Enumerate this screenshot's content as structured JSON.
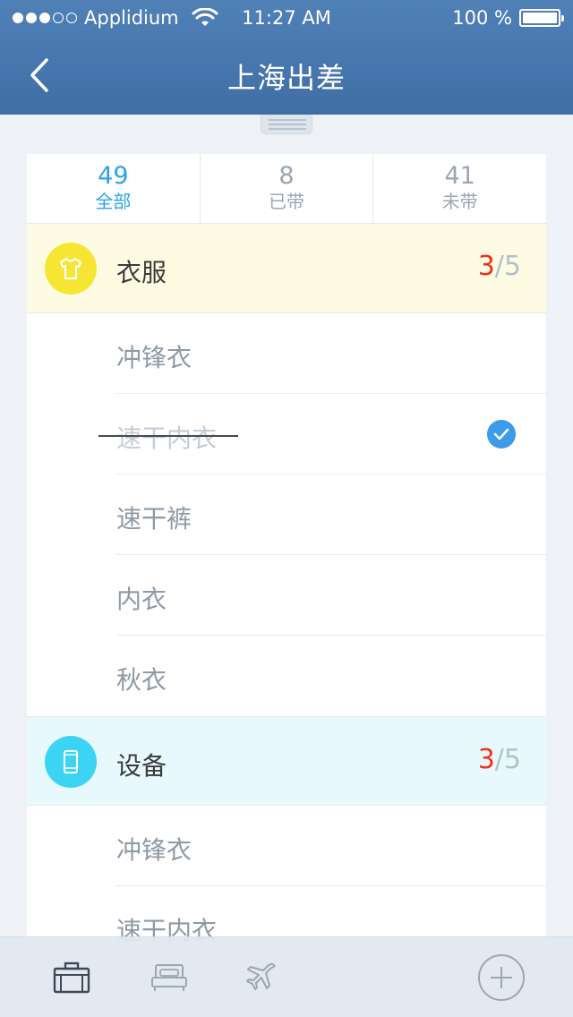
{
  "status": {
    "carrier": "Applidium",
    "time": "11:27 AM",
    "battery": "100 %"
  },
  "header": {
    "title": "上海出差"
  },
  "tabs": [
    {
      "count": "49",
      "label": "全部"
    },
    {
      "count": "8",
      "label": "已带"
    },
    {
      "count": "41",
      "label": "未带"
    }
  ],
  "categories": [
    {
      "name": "衣服",
      "done": "3",
      "total": "/5",
      "color": "#f7e534",
      "items": [
        {
          "label": "冲锋衣",
          "checked": false
        },
        {
          "label": "速干内衣",
          "checked": true
        },
        {
          "label": "速干裤",
          "checked": false
        },
        {
          "label": "内衣",
          "checked": false
        },
        {
          "label": "秋衣",
          "checked": false
        }
      ]
    },
    {
      "name": "设备",
      "done": "3",
      "total": "/5",
      "color": "#3cd4f4",
      "items": [
        {
          "label": "冲锋衣",
          "checked": false
        },
        {
          "label": "速干内衣",
          "checked": false
        }
      ]
    }
  ],
  "tabbar": {
    "icons": [
      "suitcase-icon",
      "bed-icon",
      "airplane-icon",
      "add-icon"
    ]
  }
}
